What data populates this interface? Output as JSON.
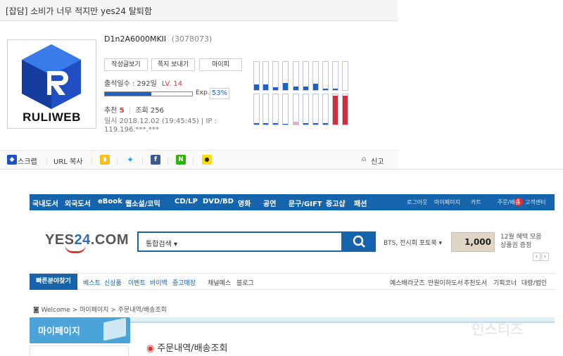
{
  "post": {
    "title": "[잡담] 소비가 너무 적지만 yes24 탈퇴함"
  },
  "profile": {
    "username": "D1n2A6000MKII",
    "user_id": "(3078073)",
    "logo_text": "RULIWEB",
    "buttons": [
      "작성글보기",
      "쪽지 보내기",
      "마이피"
    ],
    "attendance": "출석일수 : 292일",
    "level": "LV. 14",
    "exp_label": "Exp.",
    "exp_percent": "53%",
    "exp_fraction": 0.53,
    "recommend_label": "추천",
    "recommend_value": "5",
    "views": "조회 256",
    "date": "일시 2018.12.02 (19:45:45)",
    "ip": "IP : 119.196.***.***"
  },
  "activity_grid": {
    "top_row_fill": [
      0.2,
      0.2,
      0.1,
      0.25,
      0.12,
      0.12,
      0.22,
      0.04,
      0.04,
      0.0
    ],
    "bottom_row_fill": [
      0.04,
      0.04,
      0.04,
      0.03,
      0.1,
      0.04,
      0.04,
      0.04,
      0.95,
      0.95
    ],
    "top_color": "#1a62c9",
    "red_color": "#d9283a",
    "pink_color": "#f2a9b6"
  },
  "actions": {
    "scrap": "스크랩",
    "url_copy": "URL 복사",
    "report": "신고",
    "icons": [
      "kakaostory-icon",
      "twitter-icon",
      "facebook-icon",
      "naver-icon",
      "kakaotalk-icon"
    ]
  },
  "yes24": {
    "top_nav": [
      "국내도서",
      "외국도서",
      "eBook",
      "웹소설/코믹",
      "CD/LP",
      "DVD/BD",
      "영화",
      "공연",
      "문구/GIFT",
      "중고샵",
      "패션"
    ],
    "top_right": [
      "로그아웃",
      "마이페이지",
      "카트",
      "주문/배송",
      "고객센터"
    ],
    "cart_count": "1",
    "logo": "YES24.COM",
    "search_select": "통합검색",
    "keywords": "BTS, 전시회 포토북",
    "promo_amount": "1,000",
    "promo_text": [
      "12월 혜택 모음",
      "상품권 증정"
    ],
    "quick": "빠른분야찾기",
    "sub_nav_left": [
      "베스트",
      "신상품",
      "이벤트",
      "바이백",
      "중고매장",
      "채널예스",
      "블로그"
    ],
    "sub_nav_right": [
      "예스배라굿즈",
      "만원이하도서",
      "추천도서",
      "기획코너",
      "대량/법인"
    ],
    "breadcrumb": "Welcome > 마이페이지 > 주문내역/배송조회",
    "mypage_label": "마이페이지",
    "page_title": "주문내역/배송조회",
    "watermark": "인스티즈"
  }
}
